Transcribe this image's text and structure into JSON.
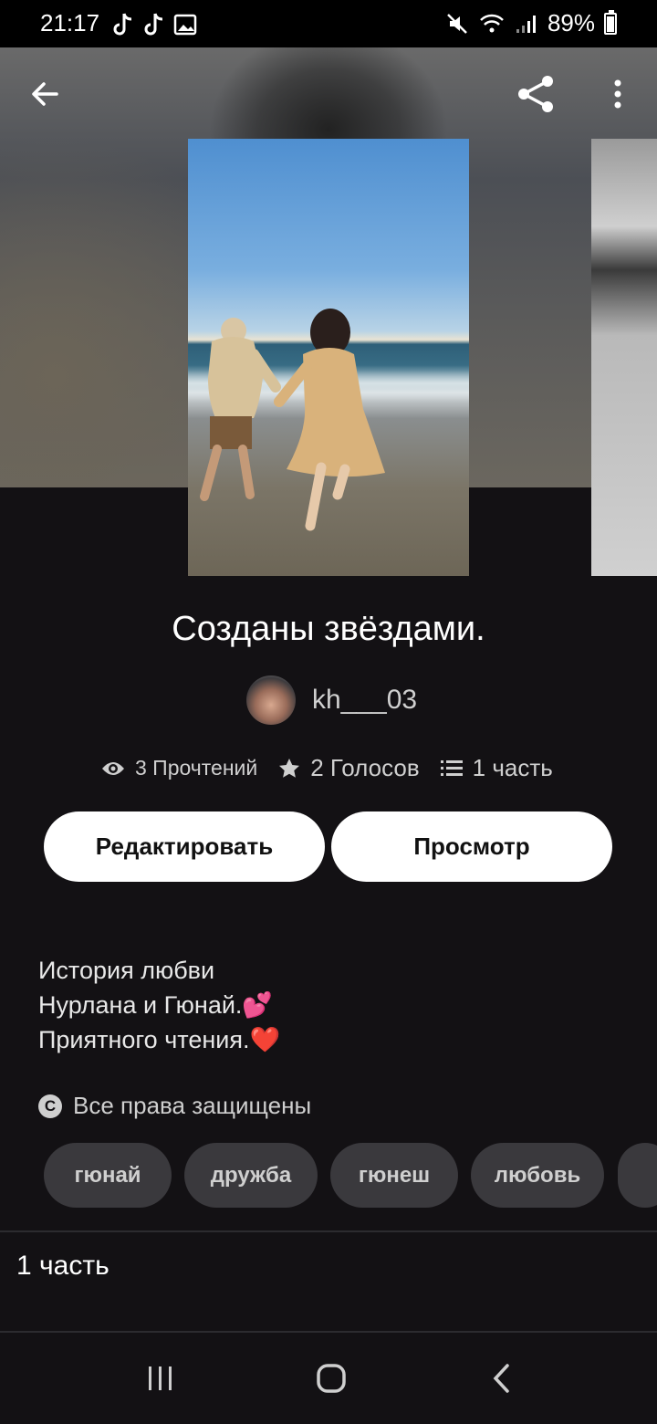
{
  "status_bar": {
    "time": "21:17",
    "battery": "89%"
  },
  "toolbar": {
    "back_icon": "arrow-left-icon",
    "share_icon": "share-icon",
    "more_icon": "more-vertical-icon"
  },
  "story": {
    "title": "Созданы звёздами.",
    "author": "kh___03",
    "stats": {
      "reads": "3 Прочтений",
      "votes": "2 Голосов",
      "parts": "1 часть"
    },
    "buttons": {
      "edit": "Редактировать",
      "view": "Просмотр"
    },
    "description": [
      "История любви",
      "Нурлана и Гюнай.💕",
      "Приятного чтения.❤️"
    ],
    "copyright": "Все права защищены",
    "tags": [
      "гюнай",
      "дружба",
      "гюнеш",
      "любовь"
    ],
    "parts_list": [
      "1 часть"
    ]
  },
  "colors": {
    "background": "#131114",
    "button_bg": "#ffffff",
    "tag_bg": "#3a393d"
  }
}
